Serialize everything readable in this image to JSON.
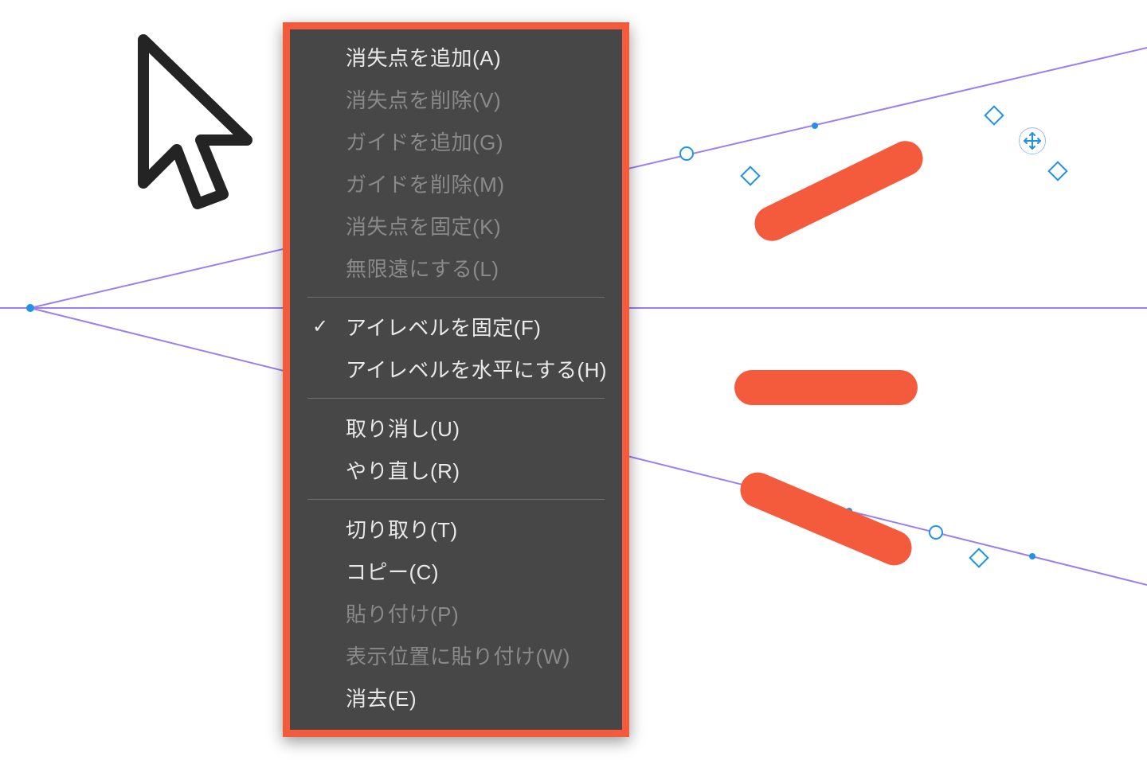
{
  "colors": {
    "menu_bg": "#474747",
    "menu_border_highlight": "#f45a3c",
    "text_enabled": "#e9e9e9",
    "text_disabled": "#8a8a8a",
    "perspective_line": "#9b7ef0",
    "handle_blue": "#2193e6",
    "annotation": "#f45a3c"
  },
  "menu": {
    "groups": [
      {
        "items": [
          {
            "id": "add-vanishing-point",
            "label": "消失点を追加(A)",
            "enabled": true
          },
          {
            "id": "del-vanishing-point",
            "label": "消失点を削除(V)",
            "enabled": false
          },
          {
            "id": "add-guide",
            "label": "ガイドを追加(G)",
            "enabled": false
          },
          {
            "id": "del-guide",
            "label": "ガイドを削除(M)",
            "enabled": false
          },
          {
            "id": "fix-vanishing-point",
            "label": "消失点を固定(K)",
            "enabled": false
          },
          {
            "id": "make-infinite",
            "label": "無限遠にする(L)",
            "enabled": false
          }
        ]
      },
      {
        "items": [
          {
            "id": "fix-eye-level",
            "label": "アイレベルを固定(F)",
            "enabled": true,
            "checked": true
          },
          {
            "id": "eye-level-horizontal",
            "label": "アイレベルを水平にする(H)",
            "enabled": true
          }
        ]
      },
      {
        "items": [
          {
            "id": "undo",
            "label": "取り消し(U)",
            "enabled": true
          },
          {
            "id": "redo",
            "label": "やり直し(R)",
            "enabled": true
          }
        ]
      },
      {
        "items": [
          {
            "id": "cut",
            "label": "切り取り(T)",
            "enabled": true
          },
          {
            "id": "copy",
            "label": "コピー(C)",
            "enabled": true
          },
          {
            "id": "paste",
            "label": "貼り付け(P)",
            "enabled": false
          },
          {
            "id": "paste-in-place",
            "label": "表示位置に貼り付け(W)",
            "enabled": false
          },
          {
            "id": "clear",
            "label": "消去(E)",
            "enabled": true
          }
        ]
      }
    ]
  }
}
